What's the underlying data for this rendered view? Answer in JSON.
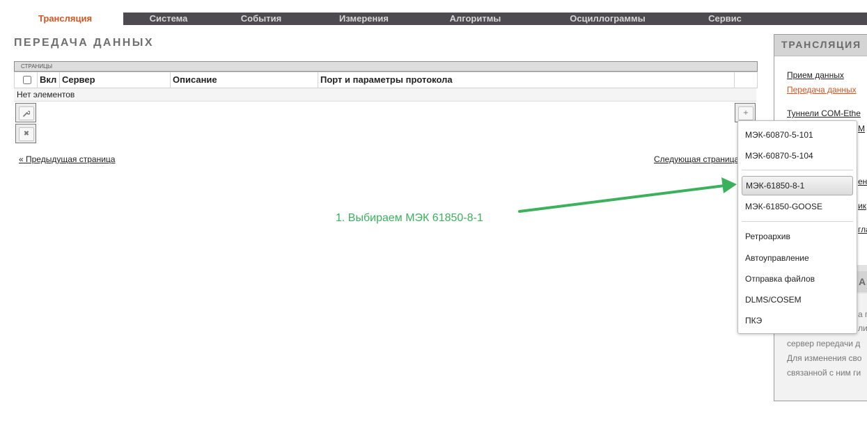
{
  "nav": {
    "tabs": [
      {
        "label": "Трансляция",
        "active": true
      },
      {
        "label": "Система"
      },
      {
        "label": "События"
      },
      {
        "label": "Измерения"
      },
      {
        "label": "Алгоритмы"
      },
      {
        "label": "Осциллограммы"
      },
      {
        "label": "Сервис"
      }
    ]
  },
  "page": {
    "title": "ПЕРЕДАЧА ДАННЫХ",
    "pages_label": "СТРАНИЦЫ"
  },
  "table": {
    "columns": [
      "Вкл",
      "Сервер",
      "Описание",
      "Порт и параметры протокола"
    ],
    "empty_text": "Нет элементов"
  },
  "pager": {
    "prev": "« Предыдущая страница",
    "next": "Следующая страница"
  },
  "dropdown": {
    "items": [
      "МЭК-60870-5-101",
      "МЭК-60870-5-104",
      "МЭК-61850-8-1",
      "МЭК-61850-GOOSE",
      "Ретроархив",
      "Автоуправление",
      "Отправка файлов",
      "DLMS/COSEM",
      "ПКЭ"
    ],
    "highlighted": "МЭК-61850-8-1"
  },
  "annotation": {
    "text": "1. Выбираем МЭК 61850-8-1"
  },
  "sidebar": {
    "title": "ТРАНСЛЯЦИЯ",
    "links": [
      "Прием данных",
      "Передача данных",
      "Туннели COM-Ethe"
    ],
    "partial_fragments": [
      "М",
      "ен",
      "ик",
      "гла"
    ],
    "info_heading_fragment": "А",
    "info_lines": [
      "а п",
      "ли",
      "сервер передачи д",
      "Для изменения сво",
      "связанной с ним ги"
    ]
  },
  "colors": {
    "accent": "#d9531e",
    "nav_bg": "#4d4b4f",
    "annotation": "#3bb15c"
  }
}
